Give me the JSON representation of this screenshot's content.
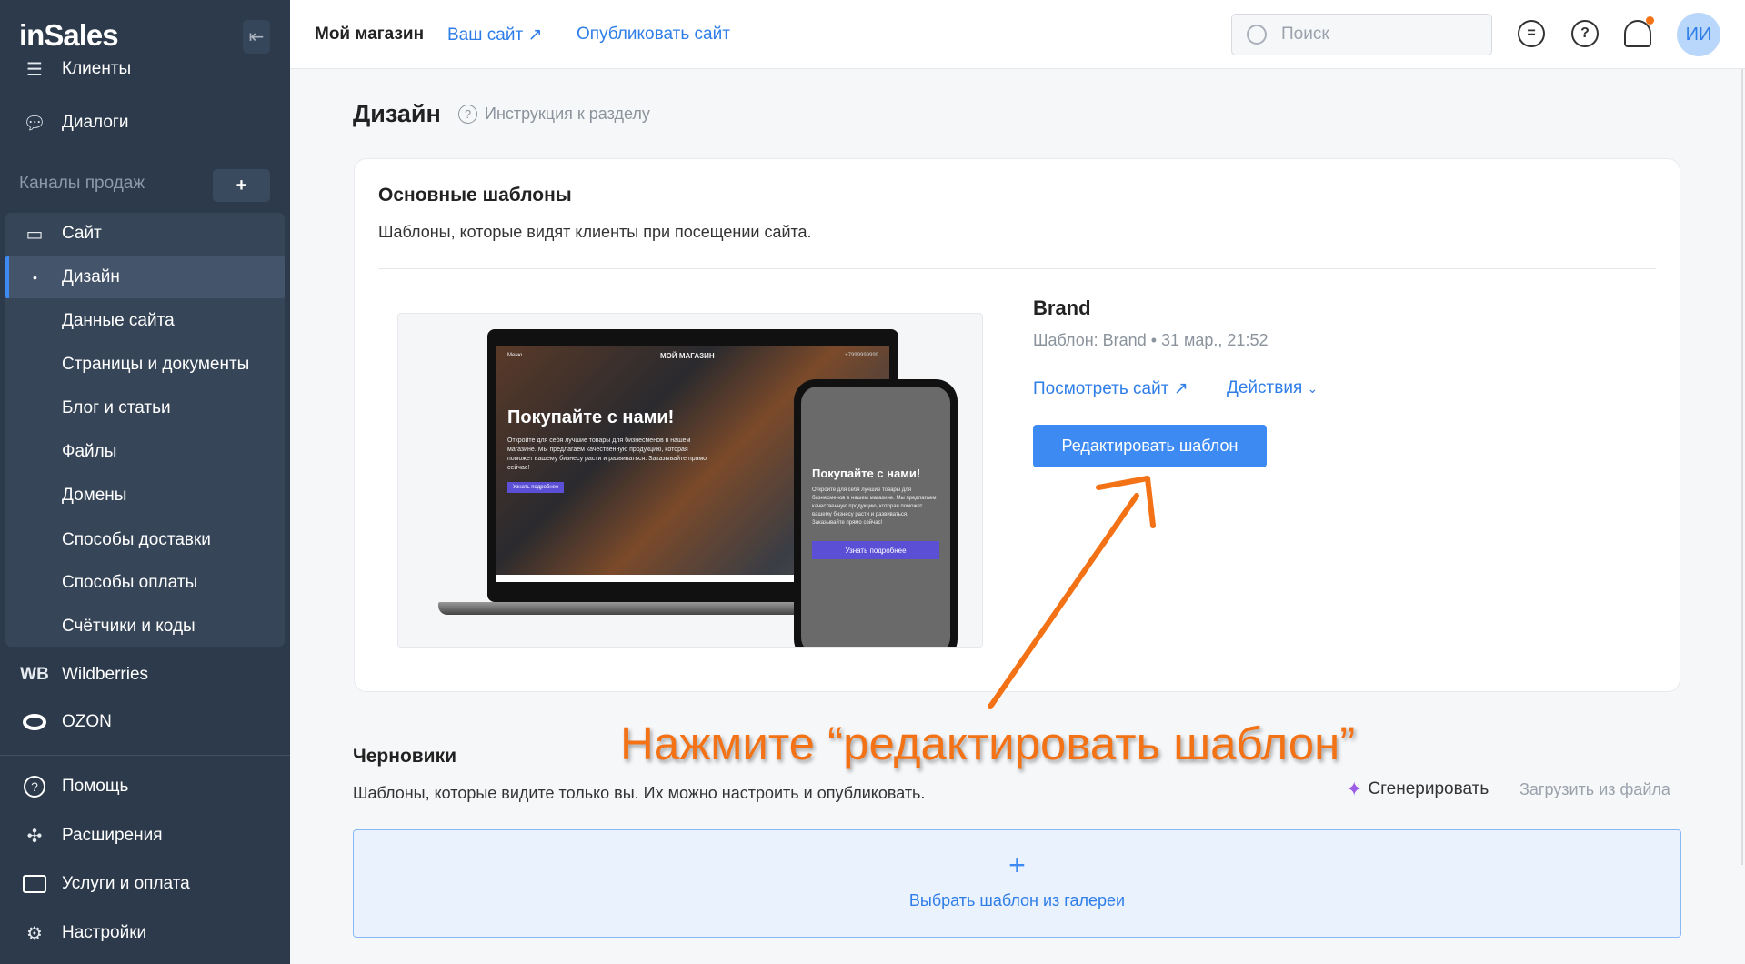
{
  "sidebar": {
    "logo": "inSales",
    "items_top": [
      {
        "label": "Клиенты"
      },
      {
        "label": "Диалоги"
      }
    ],
    "channels_label": "Каналы продаж",
    "add_label": "+",
    "site_label": "Сайт",
    "site_sub": [
      "Дизайн",
      "Данные сайта",
      "Страницы и документы",
      "Блог и статьи",
      "Файлы",
      "Домены",
      "Способы доставки",
      "Способы оплаты",
      "Счётчики и коды"
    ],
    "wb_icon": "WB",
    "wb": "Wildberries",
    "ozon": "OZON",
    "bottom": [
      "Помощь",
      "Расширения",
      "Услуги и оплата",
      "Настройки"
    ]
  },
  "topbar": {
    "store": "Мой магазин",
    "your_site": "Ваш сайт",
    "publish": "Опубликовать сайт",
    "search_placeholder": "Поиск",
    "avatar": "ИИ"
  },
  "page": {
    "title": "Дизайн",
    "help_link": "Инструкция к разделу"
  },
  "main_templates": {
    "title": "Основные шаблоны",
    "subtitle": "Шаблоны, которые видят клиенты при посещении сайта.",
    "template": {
      "name": "Brand",
      "meta": "Шаблон: Brand • 31 мар., 21:52",
      "view_site": "Посмотреть сайт",
      "actions": "Действия",
      "edit": "Редактировать шаблон"
    },
    "preview": {
      "menu": "Меню",
      "store": "МОЙ МАГАЗИН",
      "phone": "+7999999999",
      "headline": "Покупайте с нами!",
      "body": "Откройте для себя лучшие товары для бизнесменов в нашем магазине. Мы предлагаем качественную продукцию, которая поможет вашему бизнесу расти и развиваться. Заказывайте прямо сейчас!",
      "cta": "Узнать подробнее"
    }
  },
  "drafts": {
    "title": "Черновики",
    "subtitle": "Шаблоны, которые видите только вы. Их можно настроить и опубликовать.",
    "generate": "Сгенерировать",
    "upload": "Загрузить из файла",
    "gallery": "Выбрать шаблон из галереи"
  },
  "annotation": "Нажмите “редактировать шаблон”",
  "colors": {
    "accent": "#3d8bf2",
    "sidebar": "#2c3a4b",
    "annotation": "#f47216"
  }
}
